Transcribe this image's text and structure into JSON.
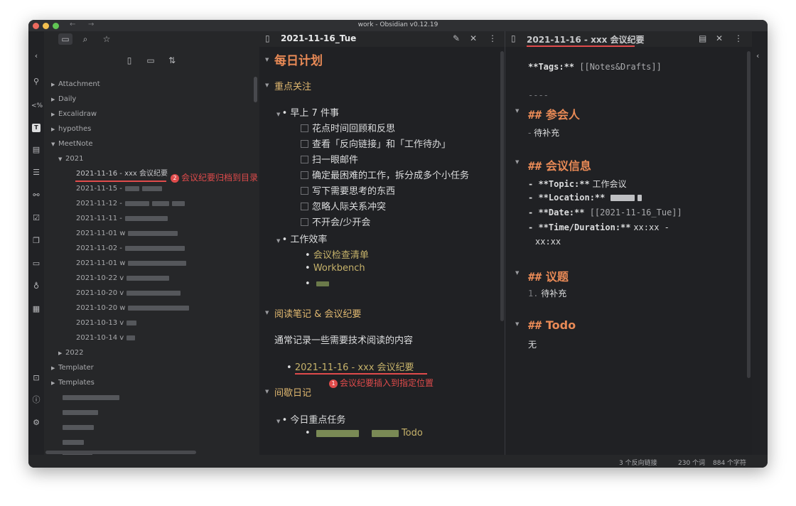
{
  "window": {
    "title": "work - Obsidian v0.12.19"
  },
  "ribbon": {
    "icons": [
      "collapse-sidebar-icon",
      "graph-icon",
      "markdown-icon",
      "templater-icon",
      "kanban-icon",
      "outline-icon",
      "mindmap-icon",
      "calendar-icon",
      "copy-icon",
      "slides-icon",
      "audio-icon",
      "table-icon",
      "vault-icon",
      "help-icon",
      "settings-icon"
    ],
    "markdown_label": "<%"
  },
  "sidebar": {
    "tree": [
      {
        "label": "Attachment",
        "type": "folder",
        "caret": "▶"
      },
      {
        "label": "Daily",
        "type": "folder",
        "caret": "▶"
      },
      {
        "label": "Excalidraw",
        "type": "folder",
        "caret": "▶"
      },
      {
        "label": "hypothes",
        "type": "folder",
        "caret": "▶"
      },
      {
        "label": "MeetNote",
        "type": "folder",
        "caret": "▼"
      },
      {
        "label": "2021",
        "type": "folder",
        "caret": "▼"
      },
      {
        "label": "2021-11-16 - xxx 会议纪要",
        "type": "file"
      },
      {
        "label": "2021-11-15 -",
        "type": "file"
      },
      {
        "label": "2021-11-12 -",
        "type": "file"
      },
      {
        "label": "2021-11-11 -",
        "type": "file"
      },
      {
        "label": "2021-11-01 w",
        "type": "file"
      },
      {
        "label": "2021-11-02 -",
        "type": "file"
      },
      {
        "label": "2021-11-01 w",
        "type": "file"
      },
      {
        "label": "2021-10-22 v",
        "type": "file"
      },
      {
        "label": "2021-10-20 v",
        "type": "file"
      },
      {
        "label": "2021-10-20 w",
        "type": "file"
      },
      {
        "label": "2021-10-13 v",
        "type": "file"
      },
      {
        "label": "2021-10-14 v",
        "type": "file"
      },
      {
        "label": "2022",
        "type": "folder",
        "caret": "▶"
      },
      {
        "label": "Templater",
        "type": "folder",
        "caret": "▶"
      },
      {
        "label": "Templates",
        "type": "folder",
        "caret": "▶"
      }
    ],
    "annotation": {
      "badge": "2",
      "text": "会议纪要归档到目录"
    }
  },
  "editor": {
    "tab_title": "2021-11-16_Tue",
    "h1": "每日计划",
    "sec1": {
      "title": "重点关注",
      "item1": "早上 7 件事",
      "tasks": [
        "花点时间回顾和反思",
        "查看「反向链接」和「工作待办」",
        "扫一眼邮件",
        "确定最困难的工作，拆分成多个小任务",
        "写下需要思考的东西",
        "忽略人际关系冲突",
        "不开会/少开会"
      ],
      "item2": "工作效率",
      "links": [
        "会议检查清单",
        "Workbench"
      ]
    },
    "sec2": {
      "title": "阅读笔记 & 会议纪要",
      "para": "通常记录一些需要技术阅读的内容",
      "link": "2021-11-16 - xxx 会议纪要"
    },
    "annotation": {
      "badge": "1",
      "text": "会议纪要插入到指定位置"
    },
    "sec3": {
      "title": "间歇日记",
      "item": "今日重点任务",
      "todo": "Todo"
    }
  },
  "preview": {
    "tab_title": "2021-11-16 - xxx 会议纪要",
    "tags_line": "**Tags:** [[Notes&Drafts]]",
    "tags_prefix": "**Tags:**",
    "tags_link": " [[Notes&Drafts]]",
    "hr": "----",
    "hash": "##",
    "s1": {
      "title": "参会人",
      "dash": "-",
      "item": "待补充"
    },
    "s2": {
      "title": "会议信息",
      "topic_key": "- **Topic:**",
      "topic_val": "工作会议",
      "location_key": "- **Location:**",
      "date_key": "- **Date:**",
      "date_val": " [[2021-11-16_Tue]]",
      "time_key": "- **Time/Duration:**",
      "time_val": "xx:xx -",
      "time_val2": "xx:xx"
    },
    "s3": {
      "title": "议题",
      "num": "1.",
      "item": "待补充"
    },
    "s4": {
      "title": "Todo",
      "item": "无"
    }
  },
  "status": {
    "backlinks": "3 个反向链接",
    "words": "230 个词",
    "chars": "884 个字符"
  }
}
